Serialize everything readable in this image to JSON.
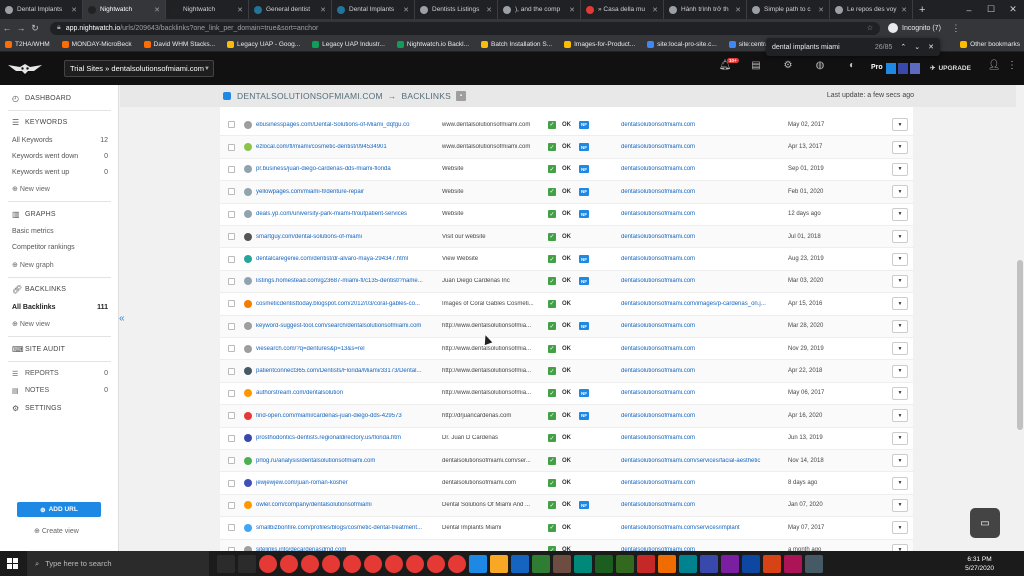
{
  "browser": {
    "tabs": [
      {
        "label": "Dental Implants",
        "color": "#9aa0a6",
        "active": false
      },
      {
        "label": "Nightwatch",
        "color": "#222222",
        "active": true
      },
      {
        "label": "Nightwatch",
        "color": "#222222",
        "active": false
      },
      {
        "label": "General dentist",
        "color": "#21759b",
        "active": false
      },
      {
        "label": "Dental Implants",
        "color": "#21759b",
        "active": false
      },
      {
        "label": "Dentists Listings",
        "color": "#9aa0a6",
        "active": false
      },
      {
        "label": "), and the comp",
        "color": "#9aa0a6",
        "active": false
      },
      {
        "label": "» Casa della mu",
        "color": "#e53935",
        "active": false
      },
      {
        "label": "Hành trình trở th",
        "color": "#9aa0a6",
        "active": false
      },
      {
        "label": "Simple path to c",
        "color": "#9aa0a6",
        "active": false
      },
      {
        "label": "Le repos des voy",
        "color": "#9aa0a6",
        "active": false
      }
    ],
    "url_host": "app.nightwatch.io",
    "url_path": "/urls/209643/backlinks?one_link_per_domain=true&sort=anchor",
    "profile": "Incognito (7)",
    "bookmarks": [
      {
        "label": "T2HA/WHM",
        "color": "#ff6d00"
      },
      {
        "label": "MONDAY-MicroBeck",
        "color": "#ff6d00"
      },
      {
        "label": "David WHM Stacks...",
        "color": "#ff6d00"
      },
      {
        "label": "Legacy UAP - Goog...",
        "color": "#fbbc04"
      },
      {
        "label": "Legacy UAP Industr...",
        "color": "#0f9d58"
      },
      {
        "label": "Nightwatch.io Backl...",
        "color": "#0f9d58"
      },
      {
        "label": "Batch Installation S...",
        "color": "#fbbc04"
      },
      {
        "label": "Images-for-Product...",
        "color": "#fbbc04"
      },
      {
        "label": "site:local-pro-site.c...",
        "color": "#4285f4"
      },
      {
        "label": "site:central-...",
        "color": "#4285f4"
      }
    ],
    "other_bookmarks": "Other bookmarks",
    "find_query": "dental implants miami",
    "find_count": "26/85"
  },
  "app": {
    "site_selector": "Trial Sites » dentalsolutionsofmiami.com",
    "badge": "10+",
    "plan": "Pro",
    "upgrade": "UPGRADE",
    "breadcrumb_site": "DENTALSOLUTIONSOFMIAMI.COM",
    "breadcrumb_sep": "→",
    "breadcrumb_page": "BACKLINKS",
    "last_update": "Last update: a few secs ago"
  },
  "sidebar": {
    "dashboard": "DASHBOARD",
    "keywords": "KEYWORDS",
    "all_keywords": "All Keywords",
    "all_keywords_count": "12",
    "kw_down": "Keywords went down",
    "kw_down_count": "0",
    "kw_up": "Keywords went up",
    "kw_up_count": "0",
    "new_view": "New view",
    "graphs": "GRAPHS",
    "basic_metrics": "Basic metrics",
    "competitor_rankings": "Competitor rankings",
    "new_graph": "New graph",
    "backlinks": "BACKLINKS",
    "all_backlinks": "All Backlinks",
    "all_backlinks_count": "111",
    "new_view_2": "New view",
    "site_audit": "SITE AUDIT",
    "reports": "REPORTS",
    "reports_count": "0",
    "notes": "NOTES",
    "notes_count": "0",
    "settings": "SETTINGS",
    "add_url": "ADD URL",
    "create_view": "Create view"
  },
  "status_ok": "OK",
  "nofollow": "NF",
  "backlinks": [
    {
      "source": "ebusinesspages.com/Dental-Solutions-of-Miami_dqfgu.co",
      "anchor": "www.dentalsolutionsofmiami.com",
      "nf": true,
      "target": "dentalsolutionsofmiami.com",
      "date": "May 02, 2017",
      "fav": "#9e9e9e"
    },
    {
      "source": "ezlocal.com/fl/miami/cosmetic-dentist/094534901",
      "anchor": "www.dentalsolutionsofmiami.com",
      "nf": true,
      "target": "dentalsolutionsofmiami.com",
      "date": "Apr 13, 2017",
      "fav": "#8bc34a"
    },
    {
      "source": "pr.business/juan-diego-cardenas-dds-miami-florida",
      "anchor": "Website",
      "nf": true,
      "target": "dentalsolutionsofmiami.com",
      "date": "Sep 01, 2019",
      "fav": "#90a4ae"
    },
    {
      "source": "yellowpages.com/miami-fl/denture-repair",
      "anchor": "Website",
      "nf": true,
      "target": "dentalsolutionsofmiami.com",
      "date": "Feb 01, 2020",
      "fav": "#90a4ae"
    },
    {
      "source": "deals.yp.com/university-park-miami-fl/outpatient-services",
      "anchor": "Website",
      "nf": true,
      "target": "dentalsolutionsofmiami.com",
      "date": "12 days ago",
      "fav": "#90a4ae"
    },
    {
      "source": "smartguy.com/dental-solutions-of-miami",
      "anchor": "Visit our website",
      "nf": false,
      "target": "dentalsolutionsofmiami.com",
      "date": "Jul 01, 2018",
      "fav": "#555555"
    },
    {
      "source": "dentalcaregenie.com/dentist/dr-alvaro-maya-294347.html",
      "anchor": "View Website",
      "nf": true,
      "target": "dentalsolutionsofmiami.com",
      "date": "Aug 23, 2019",
      "fav": "#26a69a"
    },
    {
      "source": "listings.homestead.com/g23687-miami-fl/c135-dentist/?name...",
      "anchor": "Juan Diego Cardenas Inc",
      "nf": true,
      "target": "dentalsolutionsofmiami.com",
      "date": "Mar 03, 2020",
      "fav": "#90a4ae"
    },
    {
      "source": "cosmeticdentisttoday.blogspot.com/2012/03/coral-gables-co...",
      "anchor": "Images of Coral Gables Cosmeti...",
      "nf": false,
      "target": "dentalsolutionsofmiami.com/images/p-cardenas_on.j...",
      "date": "Apr 15, 2016",
      "fav": "#f57c00"
    },
    {
      "source": "keyword-suggest-tool.com/search/dentalsolutionsofmiami.com",
      "anchor": "http://www.dentalsolutionsofmia...",
      "nf": true,
      "target": "dentalsolutionsofmiami.com",
      "date": "Mar 28, 2020",
      "fav": "#9e9e9e"
    },
    {
      "source": "viesearch.com/?q=dentures&p=13&s=rel",
      "anchor": "http://www.dentalsolutionsofmia...",
      "nf": false,
      "target": "dentalsolutionsofmiami.com",
      "date": "Nov 29, 2019",
      "fav": "#9e9e9e"
    },
    {
      "source": "patientconnect365.com/Dentists/Florida/Miami/33173/Dental...",
      "anchor": "http://www.dentalsolutionsofmia...",
      "nf": false,
      "target": "dentalsolutionsofmiami.com",
      "date": "Apr 22, 2018",
      "fav": "#455a64"
    },
    {
      "source": "authorstream.com/dentalsolution",
      "anchor": "http://www.dentalsolutionsofmia...",
      "nf": true,
      "target": "dentalsolutionsofmiami.com",
      "date": "May 06, 2017",
      "fav": "#ff9800"
    },
    {
      "source": "find-open.com/miami/cardenas-juan-diego-dds-429573",
      "anchor": "http://drjuancardenas.com",
      "nf": true,
      "target": "dentalsolutionsofmiami.com",
      "date": "Apr 16, 2020",
      "fav": "#e53935"
    },
    {
      "source": "prosthodontics-dentists.regionaldirectory.us/florida.htm",
      "anchor": "Dr. Juan D Cardenas",
      "nf": false,
      "target": "dentalsolutionsofmiami.com",
      "date": "Jun 13, 2019",
      "fav": "#3949ab"
    },
    {
      "source": "prlog.ru/analysis/dentalsolutionsofmiami.com",
      "anchor": "dentalsolutionsofmiami.com/ser...",
      "nf": false,
      "target": "dentalsolutionsofmiami.com/services/facial-aesthetic",
      "date": "Nov 14, 2018",
      "fav": "#4caf50"
    },
    {
      "source": "jewjewjew.com/juan-roman-kosher",
      "anchor": "dentalsolutionsofmiami.com",
      "nf": false,
      "target": "dentalsolutionsofmiami.com",
      "date": "8 days ago",
      "fav": "#3f51b5"
    },
    {
      "source": "owler.com/company/dentalsolutionsofmiami",
      "anchor": "Dental Solutions Of Miami And ...",
      "nf": true,
      "target": "dentalsolutionsofmiami.com",
      "date": "Jan 07, 2020",
      "fav": "#ff9800"
    },
    {
      "source": "smallbizbonfire.com/profiles/blogs/cosmetic-dental-treatment...",
      "anchor": "Dental Implants Miami",
      "nf": false,
      "target": "dentalsolutionsofmiami.com/services/implant",
      "date": "May 07, 2017",
      "fav": "#42a5f5"
    },
    {
      "source": "sitelinks.info/decardenasdmd.com",
      "anchor": "",
      "nf": false,
      "target": "dentalsolutionsofmiami.com",
      "date": "a month ago",
      "fav": "#9e9e9e"
    }
  ],
  "taskbar": {
    "search_placeholder": "Type here to search",
    "time": "6:31 PM",
    "date": "5/27/2020"
  }
}
